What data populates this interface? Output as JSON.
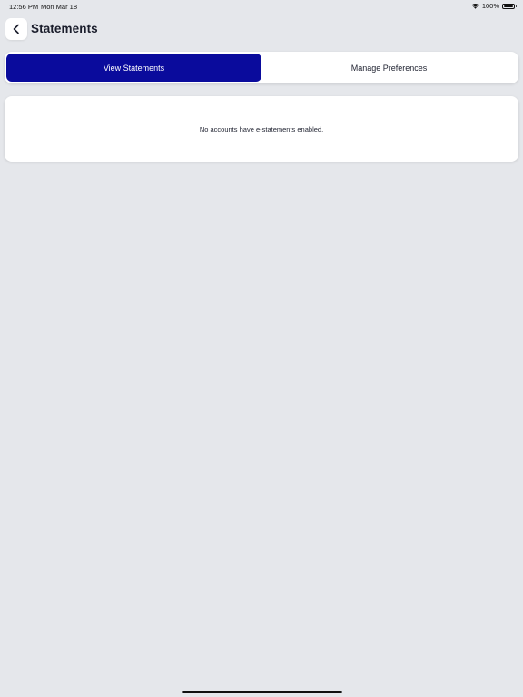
{
  "status_bar": {
    "time": "12:56 PM",
    "date": "Mon Mar 18",
    "battery": "100%",
    "wifi_icon": "wifi-icon",
    "battery_icon": "battery-icon"
  },
  "header": {
    "back_icon": "chevron-left-icon",
    "title": "Statements"
  },
  "tabs": [
    {
      "label": "View Statements",
      "active": true
    },
    {
      "label": "Manage Preferences",
      "active": false
    }
  ],
  "content": {
    "empty_message": "No accounts have e-statements enabled."
  },
  "colors": {
    "accent": "#0a0b9c",
    "background": "#e5e7eb",
    "card": "#ffffff"
  }
}
